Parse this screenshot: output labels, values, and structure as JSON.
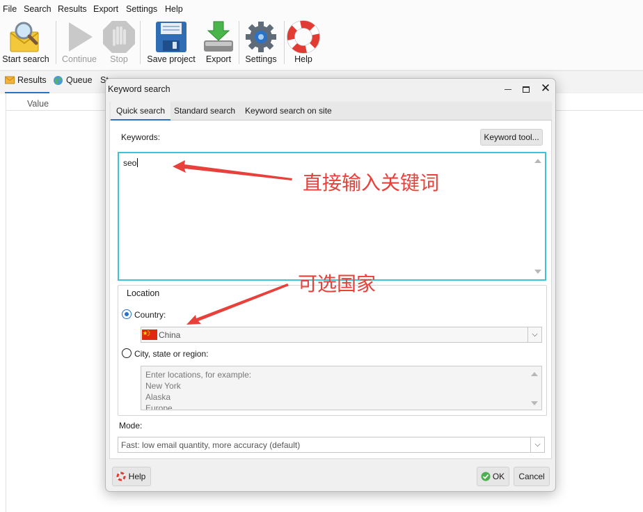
{
  "menu": [
    "File",
    "Search",
    "Results",
    "Export",
    "Settings",
    "Help"
  ],
  "toolbar": {
    "start_search": "Start search",
    "continue": "Continue",
    "stop": "Stop",
    "save_project": "Save project",
    "export": "Export",
    "settings": "Settings",
    "help": "Help"
  },
  "main_tabs": {
    "results": "Results",
    "queue": "Queue",
    "partial": "St"
  },
  "grid": {
    "column_value": "Value"
  },
  "dialog": {
    "title": "Keyword search",
    "tabs": {
      "quick": "Quick search",
      "standard": "Standard search",
      "on_site": "Keyword search on site"
    },
    "keywords_label": "Keywords:",
    "keyword_tool_button": "Keyword tool...",
    "keywords_value": "seo",
    "location": {
      "group_label": "Location",
      "country_label": "Country:",
      "country_value": "China",
      "city_label": "City, state or region:",
      "city_placeholder_lines": [
        "Enter locations, for example:",
        "New York",
        "Alaska",
        "Europe"
      ]
    },
    "mode_label": "Mode:",
    "mode_value": "Fast: low email quantity, more accuracy (default)",
    "help_button": "Help",
    "ok_button": "OK",
    "cancel_button": "Cancel"
  },
  "annotations": {
    "keywords_hint": "直接输入关键词",
    "country_hint": "可选国家"
  },
  "colors": {
    "accent": "#2a72c8",
    "focus_border": "#3ec3d6",
    "annotation": "#e8403a"
  }
}
